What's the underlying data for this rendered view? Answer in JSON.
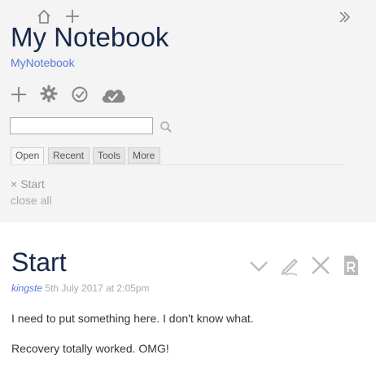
{
  "sidebar": {
    "title": "My Notebook",
    "subtitle": "MyNotebook",
    "search": {
      "value": "",
      "placeholder": ""
    },
    "tabs": [
      {
        "label": "Open",
        "active": true
      },
      {
        "label": "Recent",
        "active": false
      },
      {
        "label": "Tools",
        "active": false
      },
      {
        "label": "More",
        "active": false
      }
    ],
    "open_items": [
      {
        "close": "×",
        "label": "Start"
      }
    ],
    "close_all": "close all",
    "top_icons": [
      "home-icon",
      "new-tiddler-icon",
      "fold-bar-icon"
    ],
    "page_controls": [
      "new-tiddler-icon",
      "control-panel-icon",
      "save-check-icon",
      "cloud-save-icon"
    ]
  },
  "tiddler": {
    "title": "Start",
    "modifier": "kingste",
    "date": "5th July 2017 at 2:05pm",
    "paragraphs": [
      "I need to put something here. I don't know what.",
      "Recovery totally worked. OMG!"
    ],
    "toolbar": [
      "fold-icon",
      "edit-icon",
      "close-icon",
      "readonly-icon"
    ]
  },
  "colors": {
    "title": "#182848",
    "link": "#5778d9",
    "sidebar_bg": "#f4f4f4",
    "icon": "#bbbbbb"
  }
}
